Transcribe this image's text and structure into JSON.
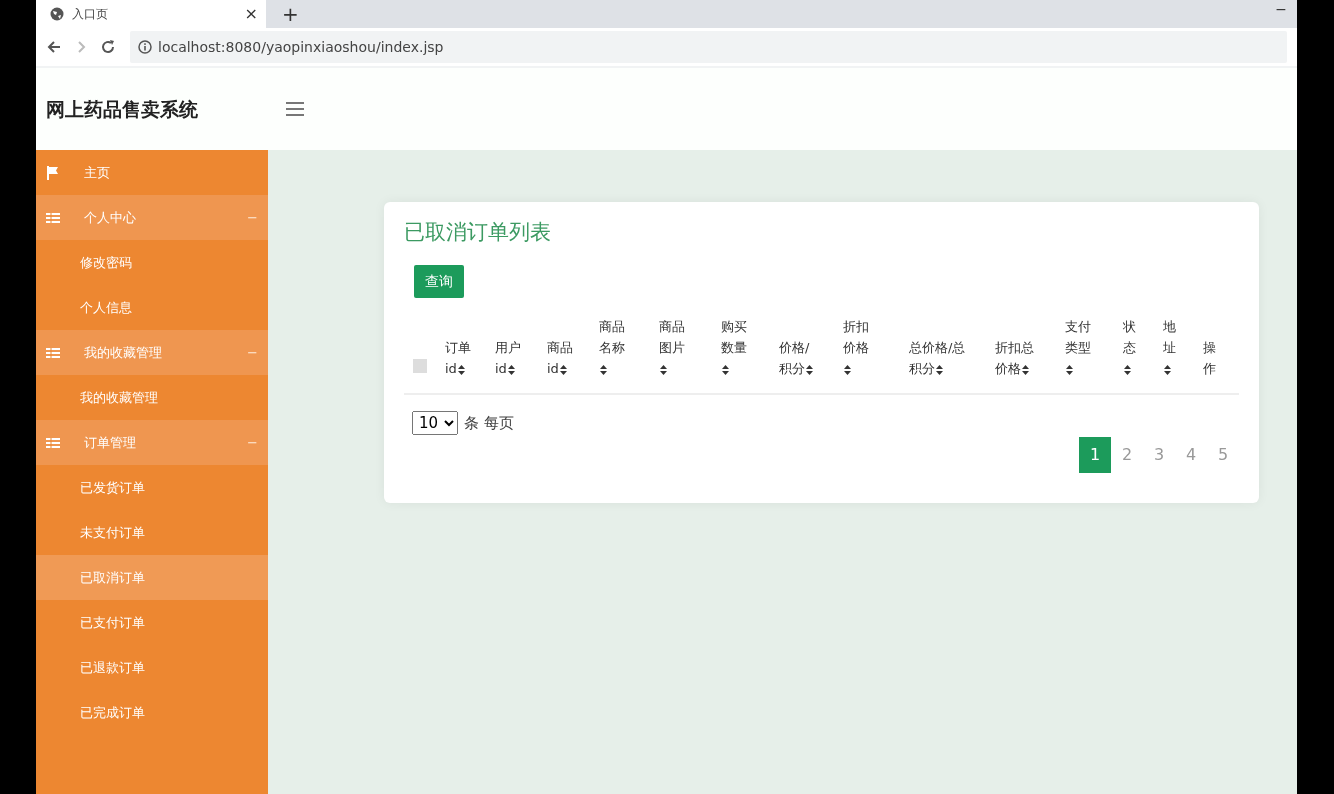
{
  "browser": {
    "tab_title": "入口页",
    "tab_close": "×",
    "new_tab": "+",
    "minimize": "−",
    "url": "localhost:8080/yaopinxiaoshou/index.jsp"
  },
  "header": {
    "brand": "网上药品售卖系统"
  },
  "sidebar": {
    "items": [
      {
        "kind": "link",
        "label": "主页",
        "selected": false
      },
      {
        "kind": "group",
        "label": "个人中心",
        "expanded": true,
        "toggle": "−",
        "children": [
          {
            "label": "修改密码",
            "selected": false
          },
          {
            "label": "个人信息",
            "selected": false
          }
        ]
      },
      {
        "kind": "group",
        "label": "我的收藏管理",
        "expanded": true,
        "toggle": "−",
        "children": [
          {
            "label": "我的收藏管理",
            "selected": false
          }
        ]
      },
      {
        "kind": "group",
        "label": "订单管理",
        "expanded": true,
        "toggle": "−",
        "children": [
          {
            "label": "已发货订单",
            "selected": false
          },
          {
            "label": "未支付订单",
            "selected": false
          },
          {
            "label": "已取消订单",
            "selected": true
          },
          {
            "label": "已支付订单",
            "selected": false
          },
          {
            "label": "已退款订单",
            "selected": false
          },
          {
            "label": "已完成订单",
            "selected": false
          }
        ]
      }
    ]
  },
  "panel": {
    "title": "已取消订单列表",
    "query_button": "查询",
    "table": {
      "select_all_checked": false,
      "columns": [
        {
          "label": "订单id",
          "sortable": true
        },
        {
          "label": "用户id",
          "sortable": true
        },
        {
          "label": "商品id",
          "sortable": true
        },
        {
          "label": "商品名称",
          "sortable": true
        },
        {
          "label": "商品图片",
          "sortable": true
        },
        {
          "label": "购买数量",
          "sortable": true
        },
        {
          "label": "价格/积分",
          "sortable": true
        },
        {
          "label": "折扣价格",
          "sortable": true
        },
        {
          "label": "总价格/总积分",
          "sortable": true
        },
        {
          "label": "折扣总价格",
          "sortable": true
        },
        {
          "label": "支付类型",
          "sortable": true
        },
        {
          "label": "状态",
          "sortable": true
        },
        {
          "label": "地址",
          "sortable": true
        },
        {
          "label": "操作",
          "sortable": false
        }
      ]
    },
    "page_size": "10",
    "page_size_suffix": "条 每页",
    "pages": [
      {
        "label": "1",
        "selected": true
      },
      {
        "label": "2",
        "selected": false
      },
      {
        "label": "3",
        "selected": false
      },
      {
        "label": "4",
        "selected": false
      },
      {
        "label": "5",
        "selected": false
      }
    ]
  }
}
